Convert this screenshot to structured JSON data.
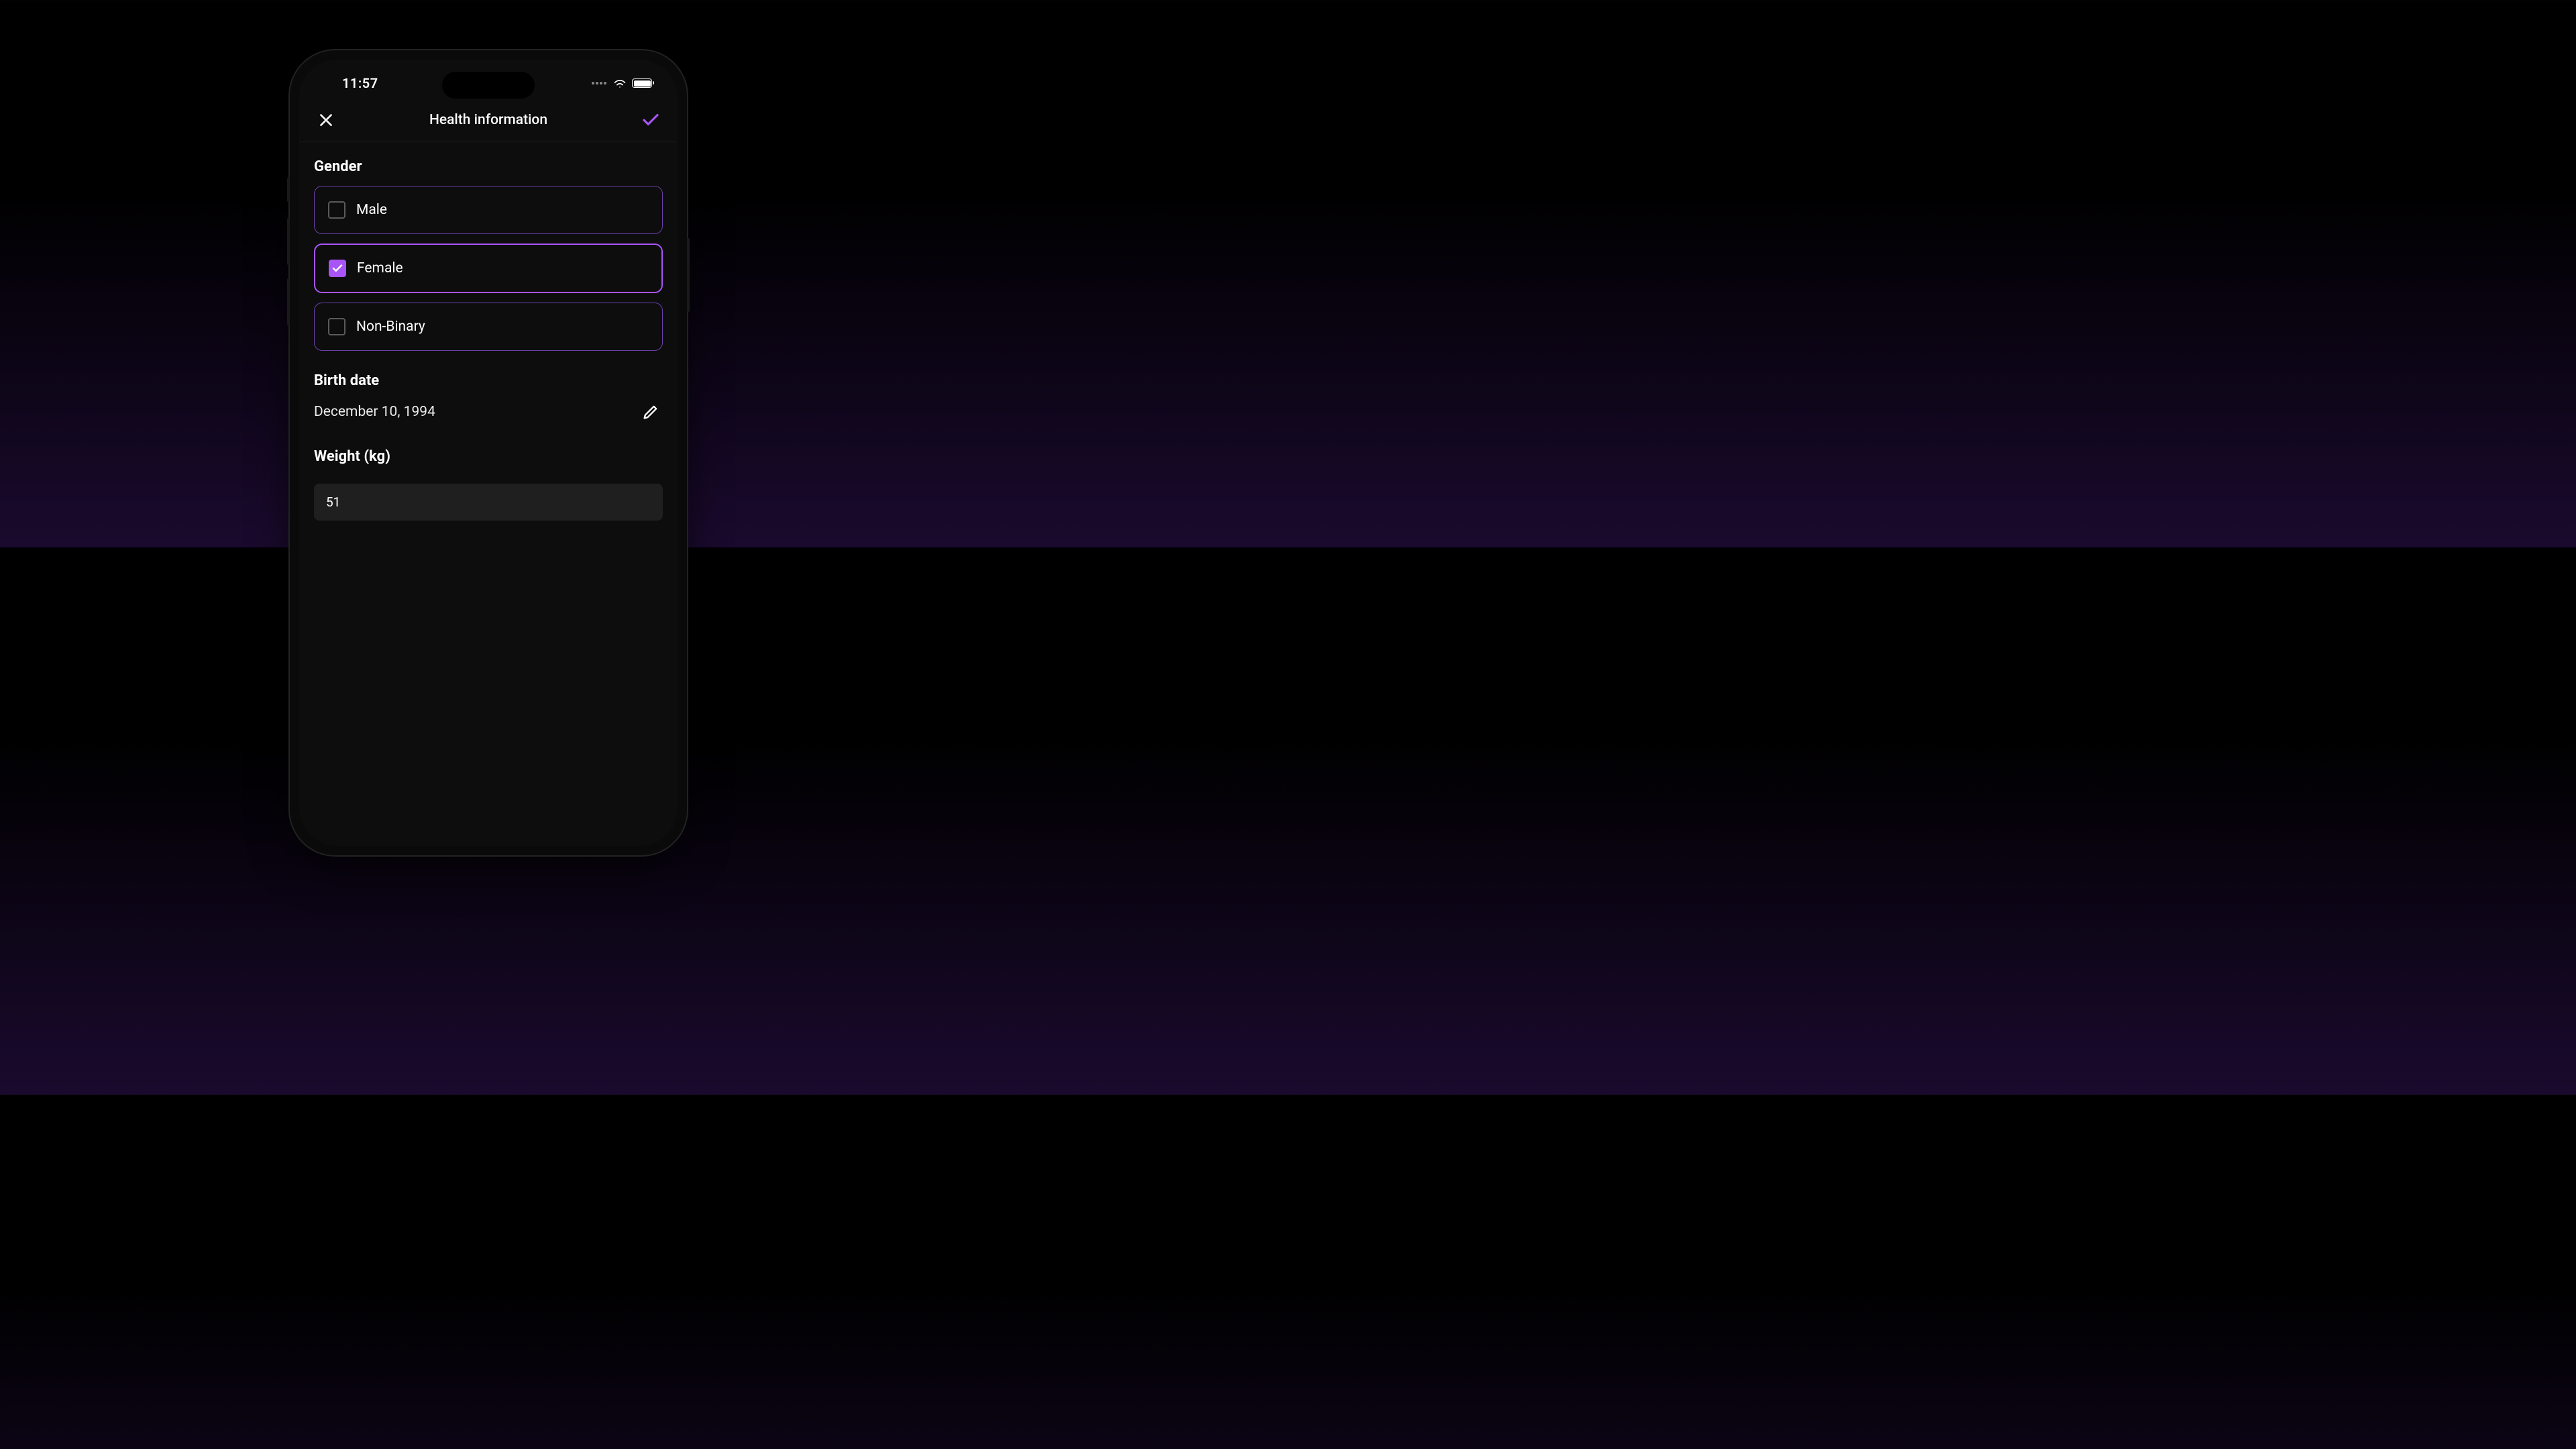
{
  "status": {
    "time": "11:57"
  },
  "nav": {
    "title": "Health information"
  },
  "gender": {
    "label": "Gender",
    "options": [
      {
        "label": "Male",
        "selected": false
      },
      {
        "label": "Female",
        "selected": true
      },
      {
        "label": "Non-Binary",
        "selected": false
      }
    ]
  },
  "birthdate": {
    "label": "Birth date",
    "value": "December 10, 1994"
  },
  "weight": {
    "label": "Weight (kg)",
    "value": "51"
  },
  "colors": {
    "accent": "#a855f7",
    "border_dim": "#6a3fa8"
  }
}
